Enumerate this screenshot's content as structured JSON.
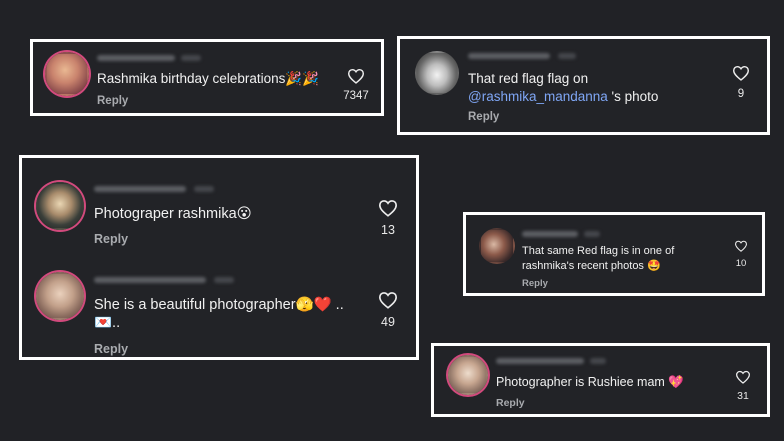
{
  "comments": [
    {
      "text": "Rashmika birthday celebrations🎉🎉",
      "reply": "Reply",
      "likes": "7347"
    },
    {
      "text_line1": "That red flag flag on",
      "mention": "@rashmika_mandanna",
      "text_line2_suffix": " 's photo",
      "reply": "Reply",
      "likes": "9"
    },
    {
      "text": "Photograper rashmika",
      "emoji": "😮",
      "reply": "Reply",
      "likes": "13"
    },
    {
      "text": "She is a beautiful photographer",
      "emoji_tail": "🫣❤️ ..",
      "line2": "💌..",
      "reply": "Reply",
      "likes": "49"
    },
    {
      "text_line1": "That same Red flag is in one of",
      "text_line2": "rashmika's recent photos",
      "emoji": "🤩",
      "reply": "Reply",
      "likes": "10"
    },
    {
      "text": "Photographer is Rushiee mam",
      "emoji": "💖",
      "reply": "Reply",
      "likes": "31"
    }
  ]
}
